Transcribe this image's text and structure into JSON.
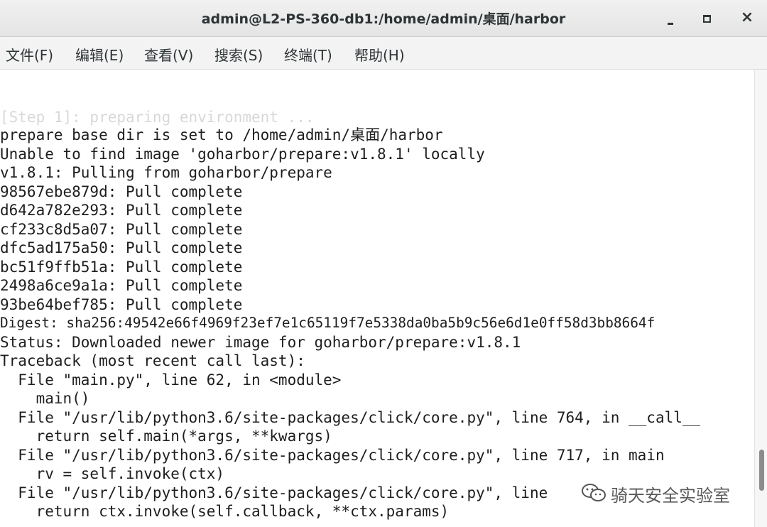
{
  "window": {
    "title": "admin@L2-PS-360-db1:/home/admin/桌面/harbor",
    "controls": {
      "minimize_icon": "minimize-icon",
      "maximize_icon": "maximize-icon",
      "close_icon": "close-icon",
      "close_glyph": "×"
    }
  },
  "menu": [
    {
      "label": "文件(F)"
    },
    {
      "label": "编辑(E)"
    },
    {
      "label": "查看(V)"
    },
    {
      "label": "搜索(S)"
    },
    {
      "label": "终端(T)"
    },
    {
      "label": "帮助(H)"
    }
  ],
  "terminal": {
    "lines": [
      "[Step 1]: preparing environment ...",
      "prepare base dir is set to /home/admin/桌面/harbor",
      "Unable to find image 'goharbor/prepare:v1.8.1' locally",
      "v1.8.1: Pulling from goharbor/prepare",
      "98567ebe879d: Pull complete",
      "d642a782e293: Pull complete",
      "cf233c8d5a07: Pull complete",
      "dfc5ad175a50: Pull complete",
      "bc51f9ffb51a: Pull complete",
      "2498a6ce9a1a: Pull complete",
      "93be64bef785: Pull complete",
      "Digest: sha256:49542e66f4969f23ef7e1c65119f7e5338da0ba5b9c56e6d1e0ff58d3bb8664f",
      "Status: Downloaded newer image for goharbor/prepare:v1.8.1",
      "Traceback (most recent call last):",
      "  File \"main.py\", line 62, in <module>",
      "    main()",
      "  File \"/usr/lib/python3.6/site-packages/click/core.py\", line 764, in __call__",
      "    return self.main(*args, **kwargs)",
      "  File \"/usr/lib/python3.6/site-packages/click/core.py\", line 717, in main",
      "    rv = self.invoke(ctx)",
      "  File \"/usr/lib/python3.6/site-packages/click/core.py\", line ",
      "    return ctx.invoke(self.callback, **ctx.params)"
    ]
  },
  "watermark": {
    "icon": "wechat-icon",
    "text": "骑天安全实验室"
  }
}
